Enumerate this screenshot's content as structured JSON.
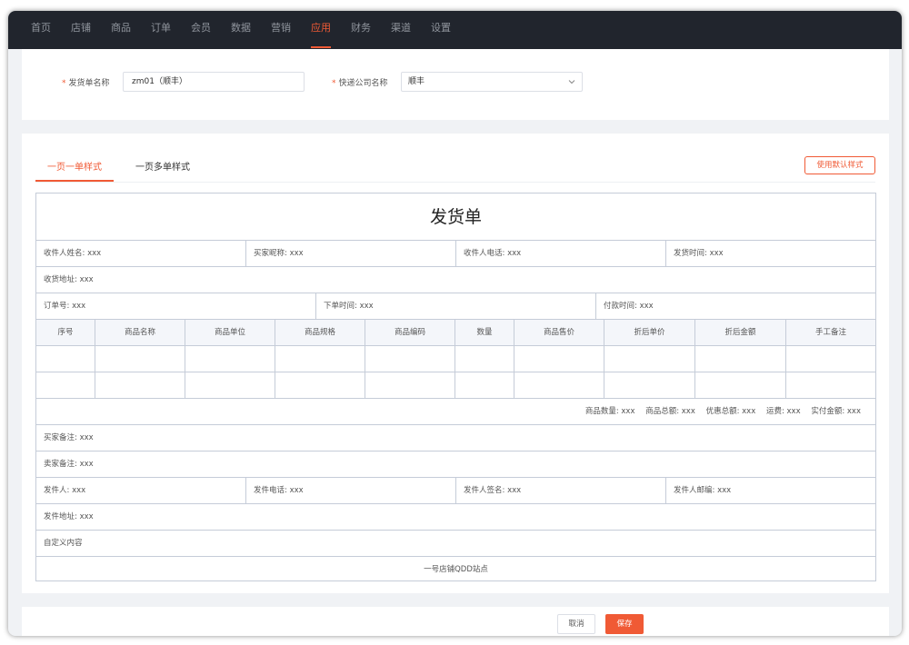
{
  "nav": {
    "items": [
      "首页",
      "店铺",
      "商品",
      "订单",
      "会员",
      "数据",
      "营销",
      "应用",
      "财务",
      "渠道",
      "设置"
    ],
    "active_index": 7
  },
  "form": {
    "invoice_name_label": "发货单名称",
    "invoice_name_value": "zm01（顺丰）",
    "courier_label": "快递公司名称",
    "courier_value": "顺丰",
    "required_mark": "*"
  },
  "tabs": [
    "一页一单样式",
    "一页多单样式"
  ],
  "default_style_button": "使用默认样式",
  "sheet": {
    "title": "发货单",
    "receiver_row": [
      "收件人姓名: xxx",
      "买家昵称: xxx",
      "收件人电话: xxx",
      "发货时间: xxx"
    ],
    "receiver_address": "收货地址: xxx",
    "order_row": [
      "订单号: xxx",
      "下单时间: xxx",
      "付款时间: xxx"
    ],
    "table_headers": [
      "序号",
      "商品名称",
      "商品单位",
      "商品规格",
      "商品编码",
      "数量",
      "商品售价",
      "折后单价",
      "折后金额",
      "手工备注"
    ],
    "totals": [
      "商品数量: xxx",
      "商品总额: xxx",
      "优惠总额: xxx",
      "运费: xxx",
      "实付金额: xxx"
    ],
    "buyer_note": "买家备注: xxx",
    "seller_note": "卖家备注: xxx",
    "sender_row": [
      "发件人: xxx",
      "发件电话: xxx",
      "发件人签名: xxx",
      "发件人邮编: xxx"
    ],
    "sender_address": "发件地址: xxx",
    "custom_content": "自定义内容",
    "footer": "一号店铺QDD站点"
  },
  "actions": {
    "cancel": "取消",
    "save": "保存"
  },
  "colors": {
    "accent": "#f05a35",
    "nav_bg": "#21252d",
    "border": "#c5ccd8"
  }
}
